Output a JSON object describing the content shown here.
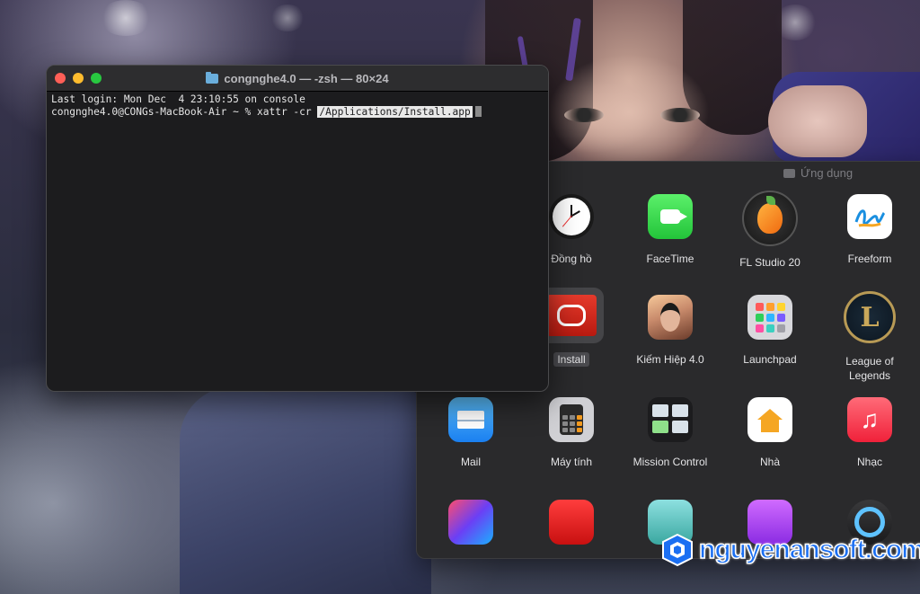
{
  "terminal": {
    "title": "congnghe4.0 — -zsh — 80×24",
    "line1": "Last login: Mon Dec  4 23:10:55 on console",
    "prompt": "congnghe4.0@CONGs-MacBook-Air ~ % xattr -cr ",
    "selected_path": "/Applications/Install.app"
  },
  "apps_window": {
    "title": "Ứng dụng",
    "apps": [
      {
        "label": "Đồng hồ",
        "icon": "clock-icon"
      },
      {
        "label": "FaceTime",
        "icon": "facetime-icon"
      },
      {
        "label": "FL Studio 20",
        "icon": "fl-studio-icon"
      },
      {
        "label": "Freeform",
        "icon": "freeform-icon"
      },
      {
        "label": "Install",
        "icon": "adobe-creative-cloud-icon"
      },
      {
        "label": "Kiếm Hiệp 4.0",
        "icon": "kiem-hiep-game-icon"
      },
      {
        "label": "Launchpad",
        "icon": "launchpad-icon"
      },
      {
        "label": "League of Legends",
        "icon": "league-of-legends-icon"
      },
      {
        "label": "Mail",
        "icon": "mail-icon"
      },
      {
        "label": "Máy tính",
        "icon": "calculator-icon"
      },
      {
        "label": "Mission Control",
        "icon": "mission-control-icon"
      },
      {
        "label": "Nhà",
        "icon": "home-icon"
      },
      {
        "label": "Nhạc",
        "icon": "music-icon"
      }
    ]
  },
  "watermark": {
    "text": "nguyenansoft.com"
  }
}
